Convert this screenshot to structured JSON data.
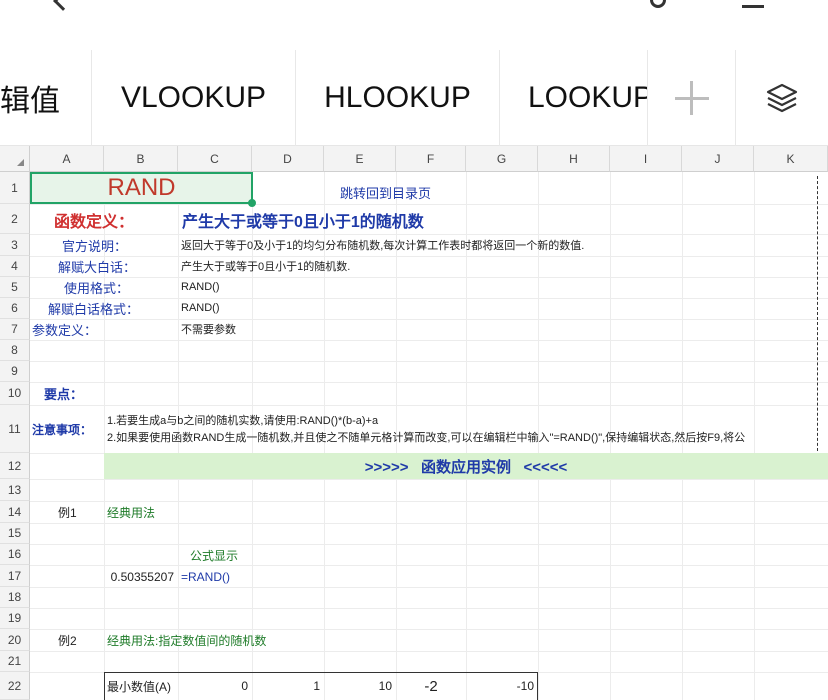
{
  "tabs": [
    "逻辑值",
    "VLOOKUP",
    "HLOOKUP",
    "LOOKUP"
  ],
  "columns": [
    "A",
    "B",
    "C",
    "D",
    "E",
    "F",
    "G",
    "H",
    "I",
    "J",
    "K"
  ],
  "rows": [
    "1",
    "2",
    "3",
    "4",
    "5",
    "6",
    "7",
    "8",
    "9",
    "10",
    "11",
    "12",
    "13",
    "14",
    "15",
    "16",
    "17",
    "18",
    "19",
    "20",
    "21",
    "22"
  ],
  "sheet": {
    "title_cell": "RAND",
    "jump_link": "跳转回到目录页",
    "def_label": "函数定义：",
    "def_text": "产生大于或等于0且小于1的随机数",
    "official_label": "官方说明：",
    "official_text": "返回大于等于0及小于1的均匀分布随机数,每次计算工作表时都将返回一个新的数值.",
    "plain_label": "解赋大白话：",
    "plain_text": "产生大于或等于0且小于1的随机数.",
    "usage_label": "使用格式：",
    "usage_text": "RAND()",
    "plain_usage_label": "解赋白话格式：",
    "plain_usage_text": "RAND()",
    "param_label": "参数定义：",
    "param_text": "不需要参数",
    "key_label": "要点：",
    "note_label": "注意事项：",
    "note_line1": "1.若要生成a与b之间的随机实数,请使用:RAND()*(b-a)+a",
    "note_line2": "2.如果要使用函数RAND生成一随机数,并且使之不随单元格计算而改变,可以在编辑栏中输入\"=RAND()\",保持编辑状态,然后按F9,将公",
    "banner": ">>>>>   函数应用实例   <<<<<",
    "ex1_label": "例1",
    "ex1_title": "经典用法",
    "formula_show": "公式显示",
    "ex1_value": "0.50355207",
    "ex1_formula": "=RAND()",
    "ex2_label": "例2",
    "ex2_title": "经典用法:指定数值间的随机数",
    "row22_label": "最小数值(A)",
    "row22_values": [
      "0",
      "1",
      "10",
      "-2",
      "-10"
    ]
  }
}
